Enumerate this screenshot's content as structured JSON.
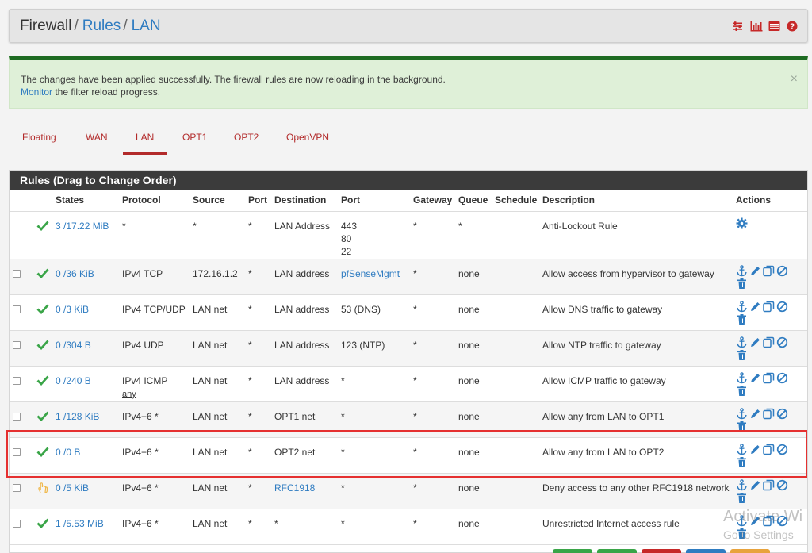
{
  "header": {
    "crumb_1": "Firewall",
    "sep_1": "/",
    "crumb_2": "Rules",
    "sep_2": "/",
    "crumb_3": "LAN",
    "icons": [
      "sliders-icon",
      "bar-chart-icon",
      "list-icon",
      "help-icon"
    ]
  },
  "alert": {
    "message": "The changes have been applied successfully. The firewall rules are now reloading in the background.",
    "link": "Monitor",
    "link_suffix": " the filter reload progress.",
    "close": "×"
  },
  "tabs": [
    "Floating",
    "WAN",
    "LAN",
    "OPT1",
    "OPT2",
    "OpenVPN"
  ],
  "active_tab": "LAN",
  "panel_title": "Rules (Drag to Change Order)",
  "columns": [
    "States",
    "Protocol",
    "Source",
    "Port",
    "Destination",
    "Port",
    "Gateway",
    "Queue",
    "Schedule",
    "Description",
    "Actions"
  ],
  "rows": [
    {
      "status": "pass",
      "states": "3 /17.22 MiB",
      "protocol": "*",
      "protocol_sub": "",
      "source": "*",
      "sport": "*",
      "dest": "LAN Address",
      "dest_link": false,
      "dport": "443\n80\n22",
      "dport_link": false,
      "gateway": "*",
      "queue": "*",
      "schedule": "",
      "desc": "Anti-Lockout Rule",
      "actions": "gear"
    },
    {
      "status": "pass",
      "states": "0 /36 KiB",
      "protocol": "IPv4 TCP",
      "protocol_sub": "",
      "source": "172.16.1.2",
      "sport": "*",
      "dest": "LAN address",
      "dest_link": false,
      "dport": "pfSenseMgmt",
      "dport_link": true,
      "gateway": "*",
      "queue": "none",
      "schedule": "",
      "desc": "Allow access from hypervisor to gateway",
      "actions": "full"
    },
    {
      "status": "pass",
      "states": "0 /3 KiB",
      "protocol": "IPv4 TCP/UDP",
      "protocol_sub": "",
      "source": "LAN net",
      "sport": "*",
      "dest": "LAN address",
      "dest_link": false,
      "dport": "53 (DNS)",
      "dport_link": false,
      "gateway": "*",
      "queue": "none",
      "schedule": "",
      "desc": "Allow DNS traffic to gateway",
      "actions": "full"
    },
    {
      "status": "pass",
      "states": "0 /304 B",
      "protocol": "IPv4 UDP",
      "protocol_sub": "",
      "source": "LAN net",
      "sport": "*",
      "dest": "LAN address",
      "dest_link": false,
      "dport": "123 (NTP)",
      "dport_link": false,
      "gateway": "*",
      "queue": "none",
      "schedule": "",
      "desc": "Allow NTP traffic to gateway",
      "actions": "full"
    },
    {
      "status": "pass",
      "states": "0 /240 B",
      "protocol": "IPv4 ICMP",
      "protocol_sub": "any",
      "source": "LAN net",
      "sport": "*",
      "dest": "LAN address",
      "dest_link": false,
      "dport": "*",
      "dport_link": false,
      "gateway": "*",
      "queue": "none",
      "schedule": "",
      "desc": "Allow ICMP traffic to gateway",
      "actions": "full"
    },
    {
      "status": "pass",
      "states": "1 /128 KiB",
      "protocol": "IPv4+6 *",
      "protocol_sub": "",
      "source": "LAN net",
      "sport": "*",
      "dest": "OPT1 net",
      "dest_link": false,
      "dport": "*",
      "dport_link": false,
      "gateway": "*",
      "queue": "none",
      "schedule": "",
      "desc": "Allow any from LAN to OPT1",
      "actions": "full"
    },
    {
      "status": "pass",
      "states": "0 /0 B",
      "protocol": "IPv4+6 *",
      "protocol_sub": "",
      "source": "LAN net",
      "sport": "*",
      "dest": "OPT2 net",
      "dest_link": false,
      "dport": "*",
      "dport_link": false,
      "gateway": "*",
      "queue": "none",
      "schedule": "",
      "desc": "Allow any from LAN to OPT2",
      "actions": "full"
    },
    {
      "status": "block",
      "states": "0 /5 KiB",
      "protocol": "IPv4+6 *",
      "protocol_sub": "",
      "source": "LAN net",
      "sport": "*",
      "dest": "RFC1918",
      "dest_link": true,
      "dport": "*",
      "dport_link": false,
      "gateway": "*",
      "queue": "none",
      "schedule": "",
      "desc": "Deny access to any other RFC1918 network",
      "actions": "full"
    },
    {
      "status": "pass",
      "states": "1 /5.53 MiB",
      "protocol": "IPv4+6 *",
      "protocol_sub": "",
      "source": "LAN net",
      "sport": "*",
      "dest": "*",
      "dest_link": false,
      "dport": "*",
      "dport_link": false,
      "gateway": "*",
      "queue": "none",
      "schedule": "",
      "desc": "Unrestricted Internet access rule",
      "actions": "full"
    }
  ],
  "watermark": {
    "line1": "Activate Wi",
    "line2": "Go to Settings"
  },
  "colors": {
    "accent": "#2f7cc1",
    "tab": "#b22a2a",
    "pass": "#3aa548",
    "highlight": "#e53030",
    "alert_bg": "#dff0d8",
    "alert_border": "#1e6b22"
  }
}
